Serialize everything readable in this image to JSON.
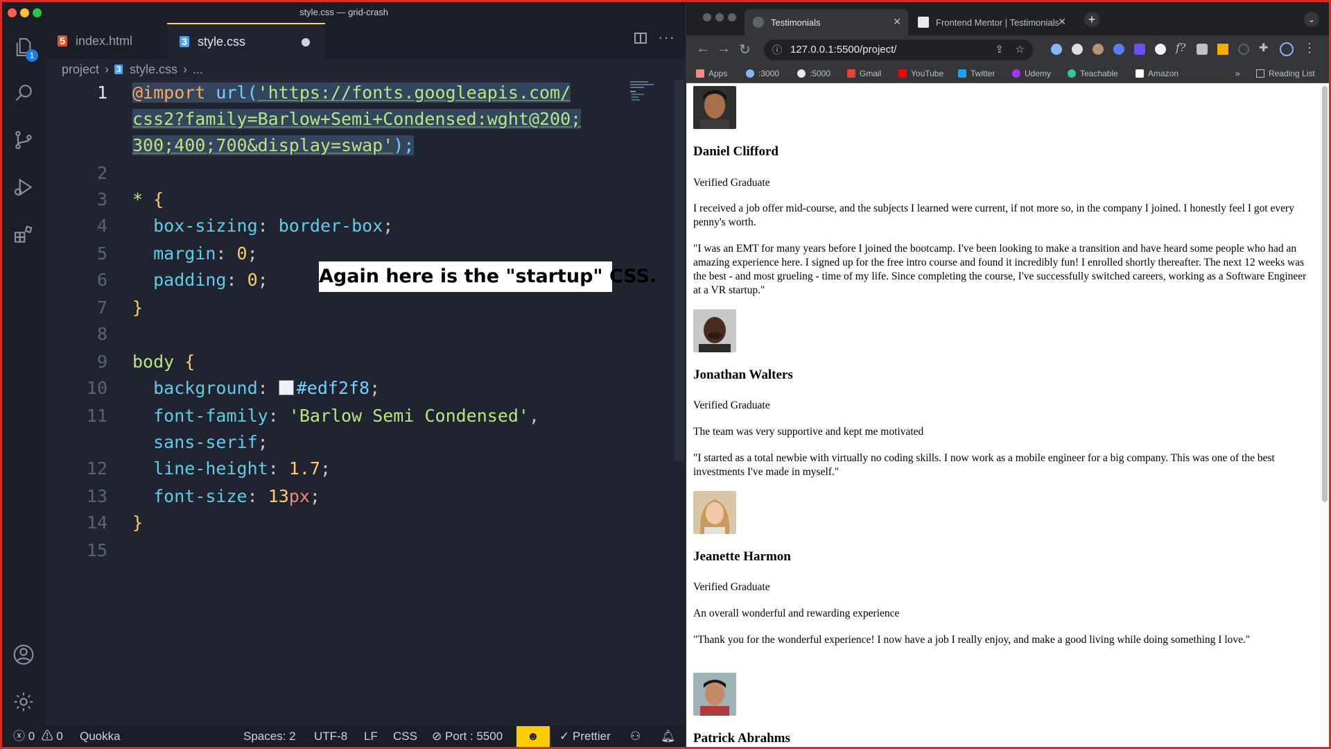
{
  "vscode": {
    "window_title": "style.css — grid-crash",
    "tabs": [
      {
        "label": "index.html",
        "icon": "html5-icon"
      },
      {
        "label": "style.css",
        "icon": "css3-icon",
        "modified": true
      }
    ],
    "breadcrumb": [
      "project",
      "style.css",
      "..."
    ],
    "explorer_badge": "1",
    "code": {
      "line1": [
        "@import",
        " url(",
        "'https://fonts.googleapis.com/",
        "css2?family=Barlow+Semi+Condensed:wght@200;",
        "300;400;700&display=swap'",
        ");"
      ],
      "line3": [
        "*",
        " {"
      ],
      "line4": [
        "box-sizing",
        ": ",
        "border-box",
        ";"
      ],
      "line5": [
        "margin",
        ": ",
        "0",
        ";"
      ],
      "line6": [
        "padding",
        ": ",
        "0",
        ";"
      ],
      "line7": "}",
      "line9": [
        "body",
        " {"
      ],
      "line10": [
        "background",
        ": ",
        "#edf2f8",
        ";"
      ],
      "line11": [
        "font-family",
        ": ",
        "'Barlow Semi Condensed'",
        ","
      ],
      "line11b": [
        "sans-serif",
        ";"
      ],
      "line12": [
        "line-height",
        ": ",
        "1.7",
        ";"
      ],
      "line13": [
        "font-size",
        ": ",
        "13",
        "px",
        ";"
      ],
      "line14": "}"
    },
    "line_numbers": [
      "1",
      "2",
      "3",
      "4",
      "5",
      "6",
      "7",
      "8",
      "9",
      "10",
      "11",
      "12",
      "13",
      "14",
      "15"
    ],
    "caption": "Again here is the \"startup\" CSS.",
    "status": {
      "errors": "0",
      "warnings": "0",
      "quokka": "Quokka",
      "spaces": "Spaces: 2",
      "encoding": "UTF-8",
      "eol": "LF",
      "language": "CSS",
      "port": "Port : 5500",
      "prettier": "Prettier"
    }
  },
  "browser": {
    "tabs": [
      {
        "title": "Testimonials",
        "active": true
      },
      {
        "title": "Frontend Mentor | Testimonials",
        "active": false
      }
    ],
    "url": "127.0.0.1:5500/project/",
    "bookmarks": [
      "Apps",
      ":3000",
      ":5000",
      "Gmail",
      "YouTube",
      "Twitter",
      "Udemy",
      "Teachable",
      "Amazon"
    ],
    "reading_list": "Reading List",
    "testimonials": [
      {
        "name": "Daniel Clifford",
        "status": "Verified Graduate",
        "headline": "I received a job offer mid-course, and the subjects I learned were current, if not more so, in the company I joined. I honestly feel I got every penny's worth.",
        "quote": "\"I was an EMT for many years before I joined the bootcamp. I've been looking to make a transition and have heard some people who had an amazing experience here. I signed up for the free intro course and found it incredibly fun! I enrolled shortly thereafter. The next 12 weeks was the best - and most grueling - time of my life. Since completing the course, I've successfully switched careers, working as a Software Engineer at a VR startup.\""
      },
      {
        "name": "Jonathan Walters",
        "status": "Verified Graduate",
        "headline": "The team was very supportive and kept me motivated",
        "quote": "\"I started as a total newbie with virtually no coding skills. I now work as a mobile engineer for a big company. This was one of the best investments I've made in myself.\""
      },
      {
        "name": "Jeanette Harmon",
        "status": "Verified Graduate",
        "headline": "An overall wonderful and rewarding experience",
        "quote": "\"Thank you for the wonderful experience! I now have a job I really enjoy, and make a good living while doing something I love.\""
      },
      {
        "name": "Patrick Abrahms",
        "status": "",
        "headline": "",
        "quote": ""
      }
    ]
  },
  "colors": {
    "editor_bg": "#1f2430",
    "accent": "#ffcc66",
    "frame": "#d82b2b"
  }
}
